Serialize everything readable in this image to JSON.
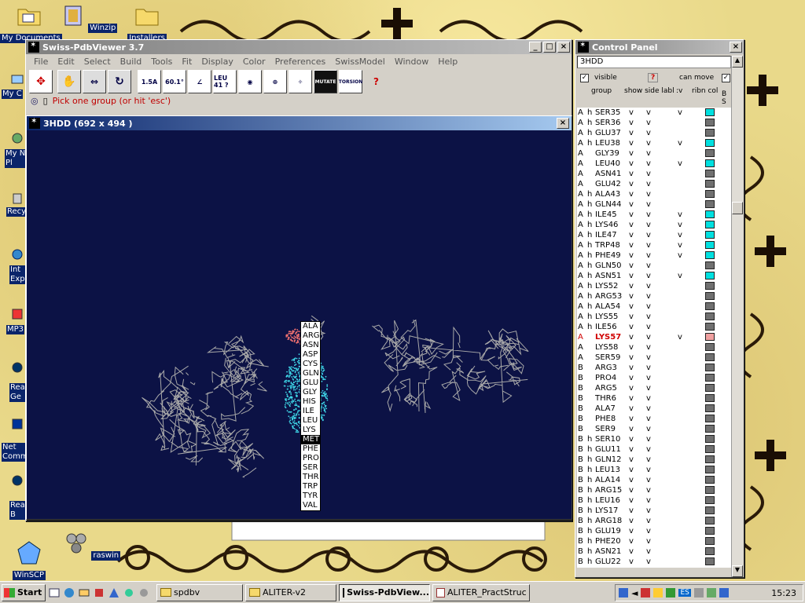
{
  "desktop": {
    "icons": [
      {
        "label": "My Documents"
      },
      {
        "label": "Winzip"
      },
      {
        "label": "Installers"
      },
      {
        "label": "My C"
      },
      {
        "label": "My N Pl"
      },
      {
        "label": "Recy"
      },
      {
        "label": "Int Exp"
      },
      {
        "label": "MP3"
      },
      {
        "label": "Rea Ge"
      },
      {
        "label": "Net Comm"
      },
      {
        "label": "Rea B"
      },
      {
        "label": "WinSCP"
      },
      {
        "label": "raswin"
      }
    ]
  },
  "pdbviewer": {
    "title": "Swiss-PdbViewer 3.7",
    "menu": [
      "File",
      "Edit",
      "Select",
      "Build",
      "Tools",
      "Fit",
      "Display",
      "Color",
      "Preferences",
      "SwissModel",
      "Window",
      "Help"
    ],
    "tools": [
      "move",
      "translate",
      "zoom",
      "rotate",
      "1.5A",
      "60.1°",
      "angle",
      "LEU 41 ?",
      "center",
      "1A",
      "fit",
      "centroid",
      "MUTATE",
      "TORSION"
    ],
    "status": "Pick one group (or hit 'esc')",
    "help_mark": "?"
  },
  "molwin": {
    "title": "3HDD  (692 x 494 )",
    "residue_menu": [
      "ALA",
      "ARG",
      "ASN",
      "ASP",
      "CYS",
      "GLN",
      "GLU",
      "GLY",
      "HIS",
      "ILE",
      "LEU",
      "LYS",
      "MET",
      "PHE",
      "PRO",
      "SER",
      "THR",
      "TRP",
      "TYR",
      "VAL"
    ],
    "selected": "MET"
  },
  "control_panel": {
    "title": "Control Panel",
    "protein": "3HDD",
    "visible_label": "visible",
    "can_move_label": "can move",
    "help_mark": "?",
    "headers": {
      "group": "group",
      "show": "show side labl",
      "v": ":v",
      "ribn": "ribn col",
      "bs": "B S"
    },
    "rows": [
      {
        "chain": "A",
        "h": "h",
        "res": "SER35",
        "show": "v",
        "side": "v",
        "v": "v",
        "color": "#00e0e0"
      },
      {
        "chain": "A",
        "h": "h",
        "res": "SER36",
        "show": "v",
        "side": "v",
        "v": "",
        "color": "#707070"
      },
      {
        "chain": "A",
        "h": "h",
        "res": "GLU37",
        "show": "v",
        "side": "v",
        "v": "",
        "color": "#707070"
      },
      {
        "chain": "A",
        "h": "h",
        "res": "LEU38",
        "show": "v",
        "side": "v",
        "v": "v",
        "color": "#00e0e0"
      },
      {
        "chain": "A",
        "h": "",
        "res": "GLY39",
        "show": "v",
        "side": "v",
        "v": "",
        "color": "#707070"
      },
      {
        "chain": "A",
        "h": "",
        "res": "LEU40",
        "show": "v",
        "side": "v",
        "v": "v",
        "color": "#00e0e0"
      },
      {
        "chain": "A",
        "h": "",
        "res": "ASN41",
        "show": "v",
        "side": "v",
        "v": "",
        "color": "#707070"
      },
      {
        "chain": "A",
        "h": "",
        "res": "GLU42",
        "show": "v",
        "side": "v",
        "v": "",
        "color": "#707070"
      },
      {
        "chain": "A",
        "h": "h",
        "res": "ALA43",
        "show": "v",
        "side": "v",
        "v": "",
        "color": "#707070"
      },
      {
        "chain": "A",
        "h": "h",
        "res": "GLN44",
        "show": "v",
        "side": "v",
        "v": "",
        "color": "#707070"
      },
      {
        "chain": "A",
        "h": "h",
        "res": "ILE45",
        "show": "v",
        "side": "v",
        "v": "v",
        "color": "#00e0e0"
      },
      {
        "chain": "A",
        "h": "h",
        "res": "LYS46",
        "show": "v",
        "side": "v",
        "v": "v",
        "color": "#00e0e0"
      },
      {
        "chain": "A",
        "h": "h",
        "res": "ILE47",
        "show": "v",
        "side": "v",
        "v": "v",
        "color": "#00e0e0"
      },
      {
        "chain": "A",
        "h": "h",
        "res": "TRP48",
        "show": "v",
        "side": "v",
        "v": "v",
        "color": "#00e0e0"
      },
      {
        "chain": "A",
        "h": "h",
        "res": "PHE49",
        "show": "v",
        "side": "v",
        "v": "v",
        "color": "#00e0e0"
      },
      {
        "chain": "A",
        "h": "h",
        "res": "GLN50",
        "show": "v",
        "side": "v",
        "v": "",
        "color": "#707070"
      },
      {
        "chain": "A",
        "h": "h",
        "res": "ASN51",
        "show": "v",
        "side": "v",
        "v": "v",
        "color": "#00e0e0"
      },
      {
        "chain": "A",
        "h": "h",
        "res": "LYS52",
        "show": "v",
        "side": "v",
        "v": "",
        "color": "#707070"
      },
      {
        "chain": "A",
        "h": "h",
        "res": "ARG53",
        "show": "v",
        "side": "v",
        "v": "",
        "color": "#707070"
      },
      {
        "chain": "A",
        "h": "h",
        "res": "ALA54",
        "show": "v",
        "side": "v",
        "v": "",
        "color": "#707070"
      },
      {
        "chain": "A",
        "h": "h",
        "res": "LYS55",
        "show": "v",
        "side": "v",
        "v": "",
        "color": "#707070"
      },
      {
        "chain": "A",
        "h": "h",
        "res": "ILE56",
        "show": "v",
        "side": "v",
        "v": "",
        "color": "#707070"
      },
      {
        "chain": "A",
        "h": "",
        "res": "LYS57",
        "show": "v",
        "side": "v",
        "v": "v",
        "color": "#f0a0a0",
        "highlight": true
      },
      {
        "chain": "A",
        "h": "",
        "res": "LYS58",
        "show": "v",
        "side": "v",
        "v": "",
        "color": "#707070"
      },
      {
        "chain": "A",
        "h": "",
        "res": "SER59",
        "show": "v",
        "side": "v",
        "v": "",
        "color": "#707070"
      },
      {
        "chain": "B",
        "h": "",
        "res": "ARG3",
        "show": "v",
        "side": "v",
        "v": "",
        "color": "#707070"
      },
      {
        "chain": "B",
        "h": "",
        "res": "PRO4",
        "show": "v",
        "side": "v",
        "v": "",
        "color": "#707070"
      },
      {
        "chain": "B",
        "h": "",
        "res": "ARG5",
        "show": "v",
        "side": "v",
        "v": "",
        "color": "#707070"
      },
      {
        "chain": "B",
        "h": "",
        "res": "THR6",
        "show": "v",
        "side": "v",
        "v": "",
        "color": "#707070"
      },
      {
        "chain": "B",
        "h": "",
        "res": "ALA7",
        "show": "v",
        "side": "v",
        "v": "",
        "color": "#707070"
      },
      {
        "chain": "B",
        "h": "",
        "res": "PHE8",
        "show": "v",
        "side": "v",
        "v": "",
        "color": "#707070"
      },
      {
        "chain": "B",
        "h": "",
        "res": "SER9",
        "show": "v",
        "side": "v",
        "v": "",
        "color": "#707070"
      },
      {
        "chain": "B",
        "h": "h",
        "res": "SER10",
        "show": "v",
        "side": "v",
        "v": "",
        "color": "#707070"
      },
      {
        "chain": "B",
        "h": "h",
        "res": "GLU11",
        "show": "v",
        "side": "v",
        "v": "",
        "color": "#707070"
      },
      {
        "chain": "B",
        "h": "h",
        "res": "GLN12",
        "show": "v",
        "side": "v",
        "v": "",
        "color": "#707070"
      },
      {
        "chain": "B",
        "h": "h",
        "res": "LEU13",
        "show": "v",
        "side": "v",
        "v": "",
        "color": "#707070"
      },
      {
        "chain": "B",
        "h": "h",
        "res": "ALA14",
        "show": "v",
        "side": "v",
        "v": "",
        "color": "#707070"
      },
      {
        "chain": "B",
        "h": "h",
        "res": "ARG15",
        "show": "v",
        "side": "v",
        "v": "",
        "color": "#707070"
      },
      {
        "chain": "B",
        "h": "h",
        "res": "LEU16",
        "show": "v",
        "side": "v",
        "v": "",
        "color": "#707070"
      },
      {
        "chain": "B",
        "h": "h",
        "res": "LYS17",
        "show": "v",
        "side": "v",
        "v": "",
        "color": "#707070"
      },
      {
        "chain": "B",
        "h": "h",
        "res": "ARG18",
        "show": "v",
        "side": "v",
        "v": "",
        "color": "#707070"
      },
      {
        "chain": "B",
        "h": "h",
        "res": "GLU19",
        "show": "v",
        "side": "v",
        "v": "",
        "color": "#707070"
      },
      {
        "chain": "B",
        "h": "h",
        "res": "PHE20",
        "show": "v",
        "side": "v",
        "v": "",
        "color": "#707070"
      },
      {
        "chain": "B",
        "h": "h",
        "res": "ASN21",
        "show": "v",
        "side": "v",
        "v": "",
        "color": "#707070"
      },
      {
        "chain": "B",
        "h": "h",
        "res": "GLU22",
        "show": "v",
        "side": "v",
        "v": "",
        "color": "#707070"
      }
    ]
  },
  "taskbar": {
    "start": "Start",
    "tasks": [
      {
        "label": "spdbv",
        "active": false
      },
      {
        "label": "ALITER-v2",
        "active": false
      },
      {
        "label": "Swiss-PdbView...",
        "active": true
      },
      {
        "label": "ALITER_PractStruc",
        "active": false
      }
    ],
    "clock": "15:23",
    "lang": "ES"
  }
}
